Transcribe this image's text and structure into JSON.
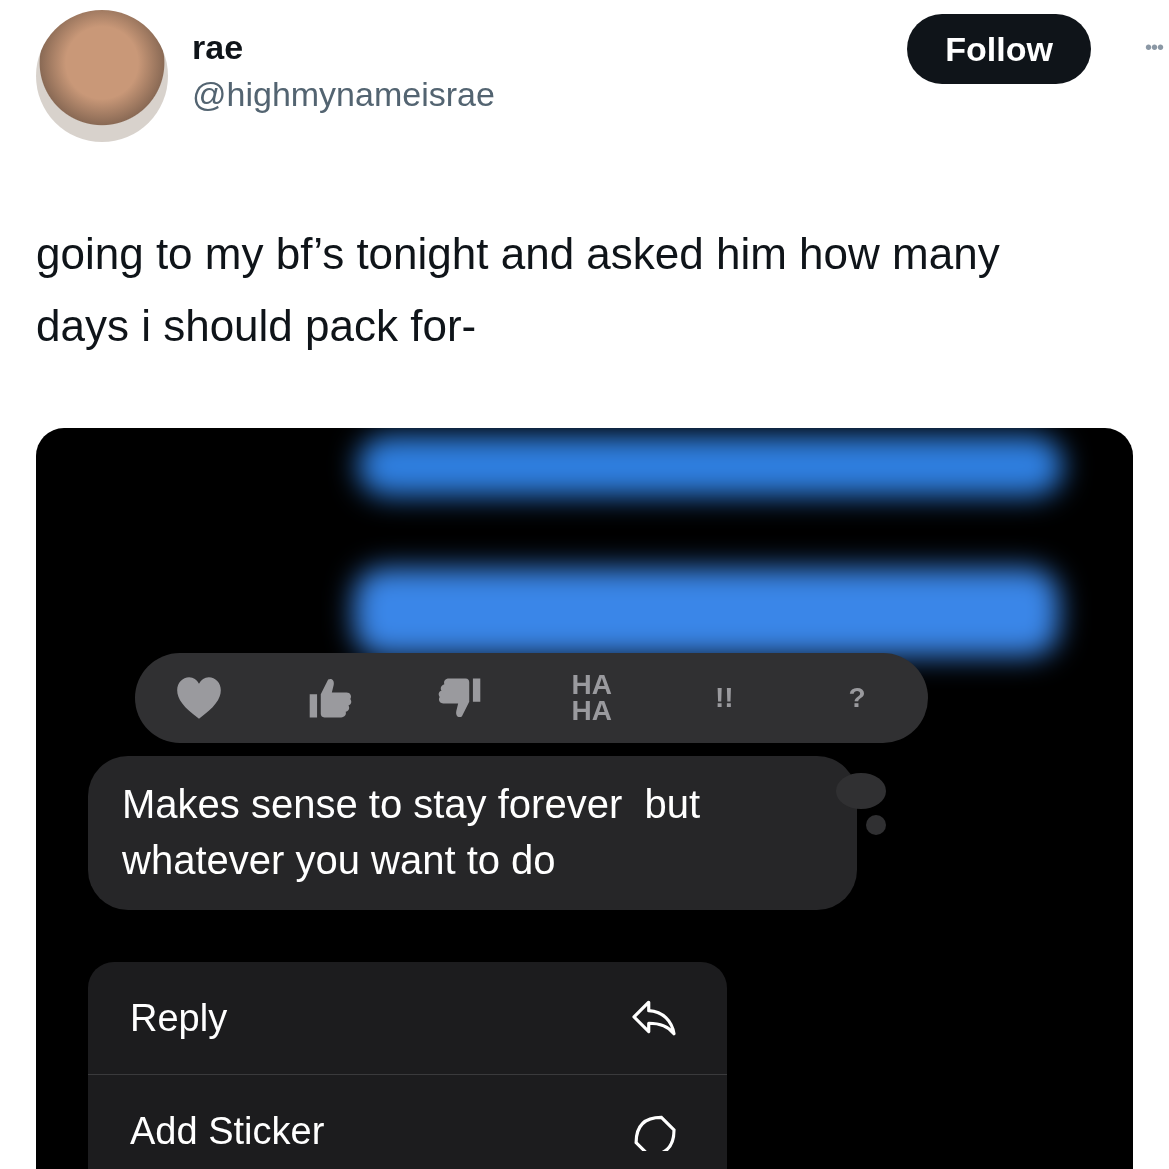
{
  "author": {
    "name": "rae",
    "handle": "@highmynameisrae"
  },
  "follow_button": {
    "label": "Follow"
  },
  "more_menu": {
    "label": "•••"
  },
  "tweet_text": "going to my bf’s tonight and asked him how many days i should pack for-",
  "media": {
    "reactions": [
      {
        "kind": "heart"
      },
      {
        "kind": "thumbs_up"
      },
      {
        "kind": "thumbs_down"
      },
      {
        "kind": "text",
        "label": "HA HA"
      },
      {
        "kind": "text",
        "label": "!!"
      },
      {
        "kind": "text",
        "label": "?"
      }
    ],
    "message": "Makes sense to stay forever  but whatever you want to do",
    "menu": [
      {
        "label": "Reply",
        "kind": "reply"
      },
      {
        "label": "Add Sticker",
        "kind": "sticker"
      }
    ]
  }
}
